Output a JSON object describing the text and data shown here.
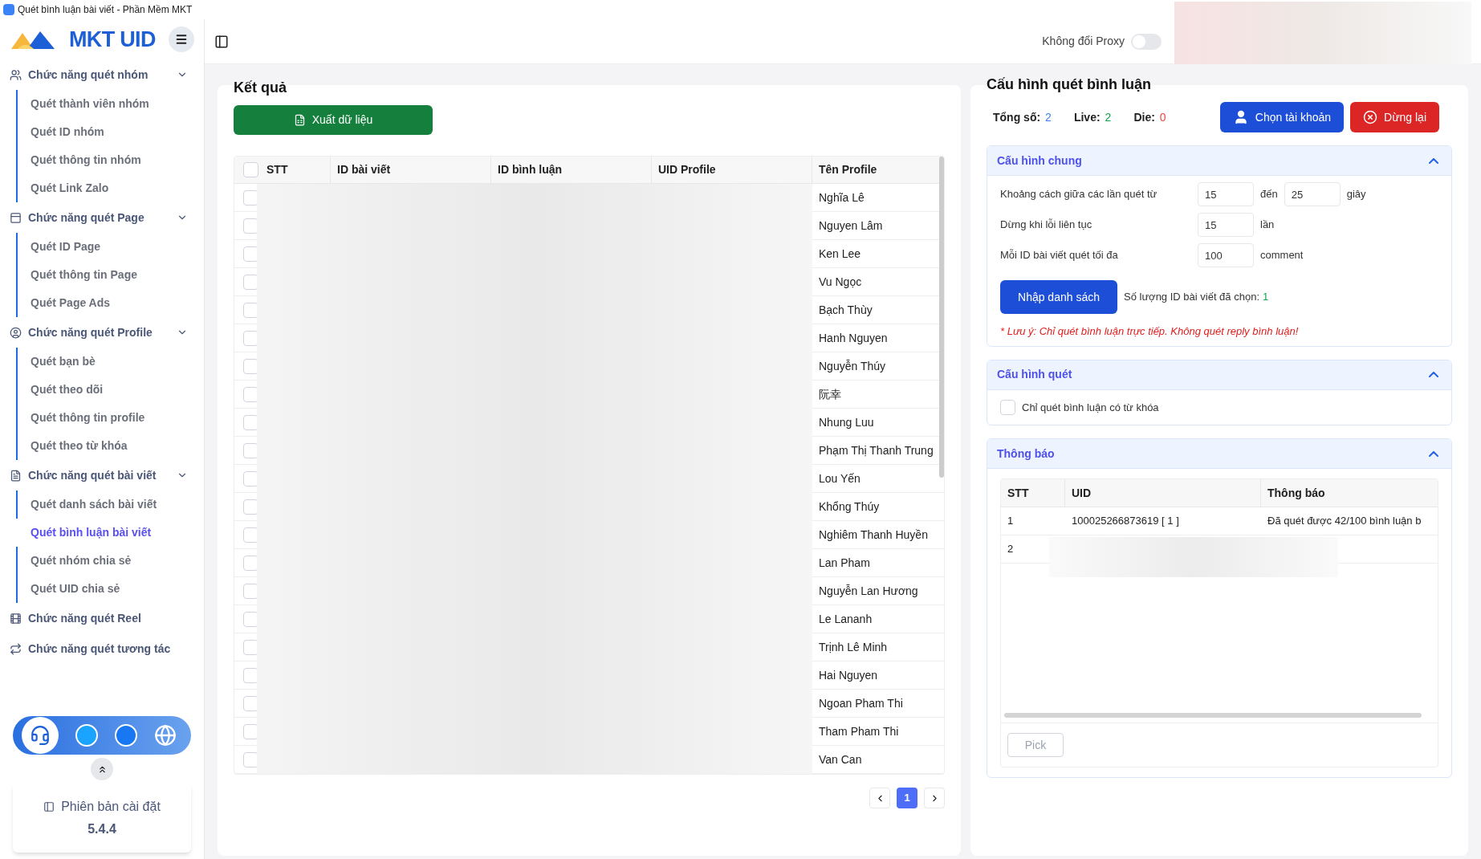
{
  "window": {
    "title": "Quét bình luận bài viết - Phần Mềm MKT"
  },
  "logo": {
    "text": "MKT UID"
  },
  "sidebar": {
    "groups": [
      {
        "label": "Chức năng quét nhóm",
        "expanded": true,
        "items": [
          {
            "label": "Quét thành viên nhóm",
            "selected": false
          },
          {
            "label": "Quét ID nhóm",
            "selected": false
          },
          {
            "label": "Quét thông tin nhóm",
            "selected": false
          },
          {
            "label": "Quét Link Zalo",
            "selected": false
          }
        ]
      },
      {
        "label": "Chức năng quét Page",
        "expanded": true,
        "items": [
          {
            "label": "Quét ID Page",
            "selected": false
          },
          {
            "label": "Quét thông tin Page",
            "selected": false
          },
          {
            "label": "Quét Page Ads",
            "selected": false
          }
        ]
      },
      {
        "label": "Chức năng quét Profile",
        "expanded": true,
        "items": [
          {
            "label": "Quét bạn bè",
            "selected": false
          },
          {
            "label": "Quét theo dõi",
            "selected": false
          },
          {
            "label": "Quét thông tin profile",
            "selected": false
          },
          {
            "label": "Quét theo từ khóa",
            "selected": false
          }
        ]
      },
      {
        "label": "Chức năng quét bài viết",
        "expanded": true,
        "items": [
          {
            "label": "Quét danh sách bài viết",
            "selected": false
          },
          {
            "label": "Quét bình luận bài viết",
            "selected": true
          },
          {
            "label": "Quét nhóm chia sẻ",
            "selected": false
          },
          {
            "label": "Quét UID chia sẻ",
            "selected": false
          }
        ]
      },
      {
        "label": "Chức năng quét Reel"
      },
      {
        "label": "Chức năng quét tương tác"
      }
    ]
  },
  "version_card": {
    "label": "Phiên bản cài đặt",
    "version": "5.4.4"
  },
  "header": {
    "proxy_toggle": {
      "label": "Không đổi Proxy",
      "on": false
    }
  },
  "results": {
    "title": "Kết quả",
    "export_button": "Xuất dữ liệu",
    "select_all_checked": false,
    "columns": [
      "STT",
      "ID bài viết",
      "ID bình luận",
      "UID Profile",
      "Tên Profile"
    ],
    "rows": [
      {
        "checked": false,
        "name": "Nghĩa Lê"
      },
      {
        "checked": false,
        "name": "Nguyen Lâm"
      },
      {
        "checked": false,
        "name": "Ken Lee"
      },
      {
        "checked": false,
        "name": "Vu Ngọc"
      },
      {
        "checked": false,
        "name": "Bạch Thùy"
      },
      {
        "checked": false,
        "name": "Hanh Nguyen"
      },
      {
        "checked": false,
        "name": "Nguyễn Thúy"
      },
      {
        "checked": false,
        "name": "阮幸"
      },
      {
        "checked": false,
        "name": "Nhung Luu"
      },
      {
        "checked": false,
        "name": "Phạm Thị Thanh Trung"
      },
      {
        "checked": false,
        "name": "Lou Yến"
      },
      {
        "checked": false,
        "name": "Khổng Thúy"
      },
      {
        "checked": false,
        "name": "Nghiêm Thanh Huyền"
      },
      {
        "checked": false,
        "name": "Lan Pham"
      },
      {
        "checked": false,
        "name": "Nguyễn Lan Hương"
      },
      {
        "checked": false,
        "name": "Le Lananh"
      },
      {
        "checked": false,
        "name": "Trịnh Lê Minh"
      },
      {
        "checked": false,
        "name": "Hai Nguyen"
      },
      {
        "checked": false,
        "name": "Ngoan Pham Thi"
      },
      {
        "checked": false,
        "name": "Tham Pham Thi"
      },
      {
        "checked": false,
        "name": "Van Can"
      }
    ],
    "pages": [
      {
        "label": "1",
        "selected": true
      }
    ]
  },
  "config": {
    "title": "Cấu hình quét bình luận",
    "stats": [
      {
        "label": "Tổng số:",
        "value": "2",
        "color": "#3b82f6"
      },
      {
        "label": "Live:",
        "value": "2",
        "color": "#16a34a"
      },
      {
        "label": "Die:",
        "value": "0",
        "color": "#ef4444"
      }
    ],
    "choose_account_button": "Chọn tài khoản",
    "stop_button": "Dừng lại",
    "general": {
      "title": "Cấu hình chung",
      "expanded": true,
      "interval": {
        "label": "Khoảng cách giữa các lần quét từ",
        "from": "15",
        "to_label": "đến",
        "to": "25",
        "unit": "giây"
      },
      "stop_on_error": {
        "label": "Dừng khi lỗi liên tục",
        "value": "15",
        "unit": "lần"
      },
      "max_comments": {
        "label": "Mỗi ID bài viết quét tối đa",
        "value": "100",
        "unit": "comment"
      },
      "import_button": "Nhập danh sách",
      "selected_count": {
        "label": "Số lượng ID bài viết đã chọn:",
        "value": "1"
      },
      "note": "* Lưu ý: Chỉ quét bình luận trực tiếp. Không quét reply bình luận!"
    },
    "scan": {
      "title": "Cấu hình quét",
      "expanded": true,
      "keyword_only": {
        "label": "Chỉ quét bình luận có từ khóa",
        "checked": false
      }
    },
    "notifications": {
      "title": "Thông báo",
      "expanded": true,
      "columns": [
        "STT",
        "UID",
        "Thông báo"
      ],
      "rows": [
        {
          "stt": "1",
          "uid": "100025266873619 [ 1 ]",
          "message": "Đã quét được 42/100 bình luận b"
        },
        {
          "stt": "2"
        }
      ],
      "pick_button": "Pick"
    }
  }
}
